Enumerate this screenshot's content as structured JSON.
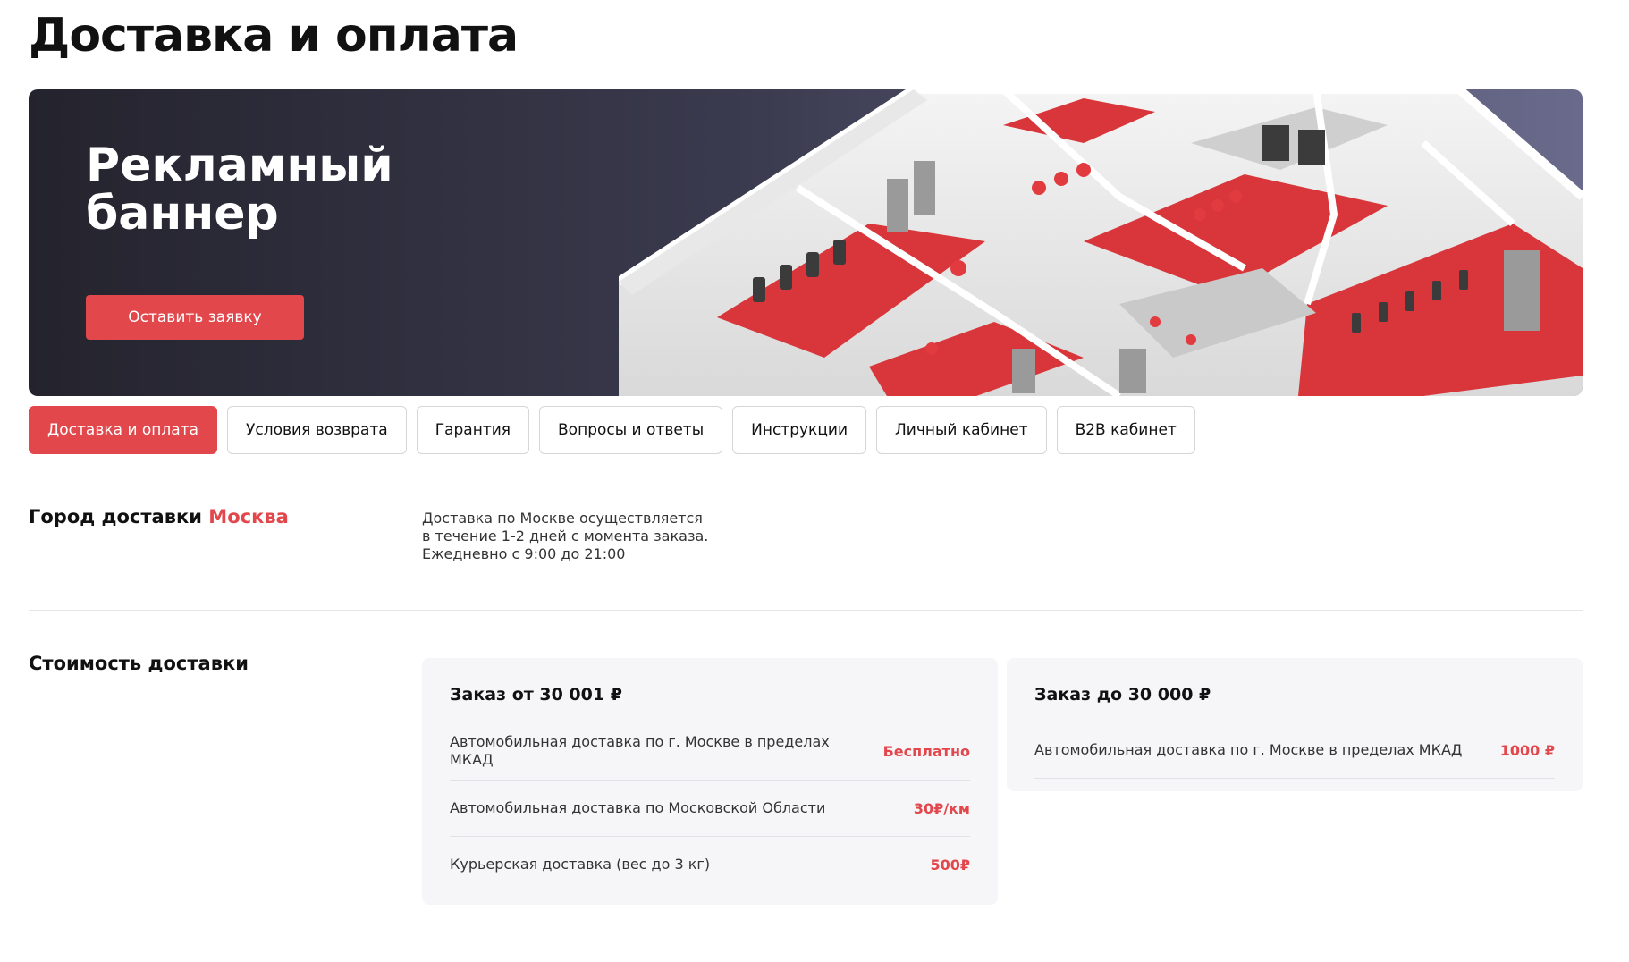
{
  "page": {
    "title": "Доставка и оплата"
  },
  "banner": {
    "title": "Рекламный баннер",
    "button_label": "Оставить заявку",
    "image": "gym-floorplan-illustration"
  },
  "tabs": [
    {
      "label": "Доставка и оплата",
      "active": true
    },
    {
      "label": "Условия возврата",
      "active": false
    },
    {
      "label": "Гарантия",
      "active": false
    },
    {
      "label": "Вопросы и ответы",
      "active": false
    },
    {
      "label": "Инструкции",
      "active": false
    },
    {
      "label": "Личный кабинет",
      "active": false
    },
    {
      "label": "B2B кабинет",
      "active": false
    }
  ],
  "city": {
    "heading_prefix": "Город доставки",
    "city_name": "Москва",
    "info_lines": [
      "Доставка по Москве осуществляется",
      "в течение 1-2 дней с момента заказа.",
      "Ежедневно с 9:00 до 21:00"
    ]
  },
  "cost": {
    "heading": "Стоимость доставки",
    "cards": [
      {
        "title": "Заказ от 30 001 ₽",
        "rows": [
          {
            "label": "Автомобильная доставка по г. Москве в пределах МКАД",
            "value": "Бесплатно"
          },
          {
            "label": "Автомобильная доставка по Московской Области",
            "value": "30₽/км"
          },
          {
            "label": "Курьерская доставка (вес до 3 кг)",
            "value": "500₽"
          }
        ]
      },
      {
        "title": "Заказ до 30 000 ₽",
        "rows": [
          {
            "label": "Автомобильная доставка по г. Москве в пределах МКАД",
            "value": "1000 ₽"
          }
        ]
      }
    ]
  },
  "colors": {
    "accent": "#e2474c",
    "banner_dark": "#24232d",
    "card_background": "#f6f6f9"
  }
}
